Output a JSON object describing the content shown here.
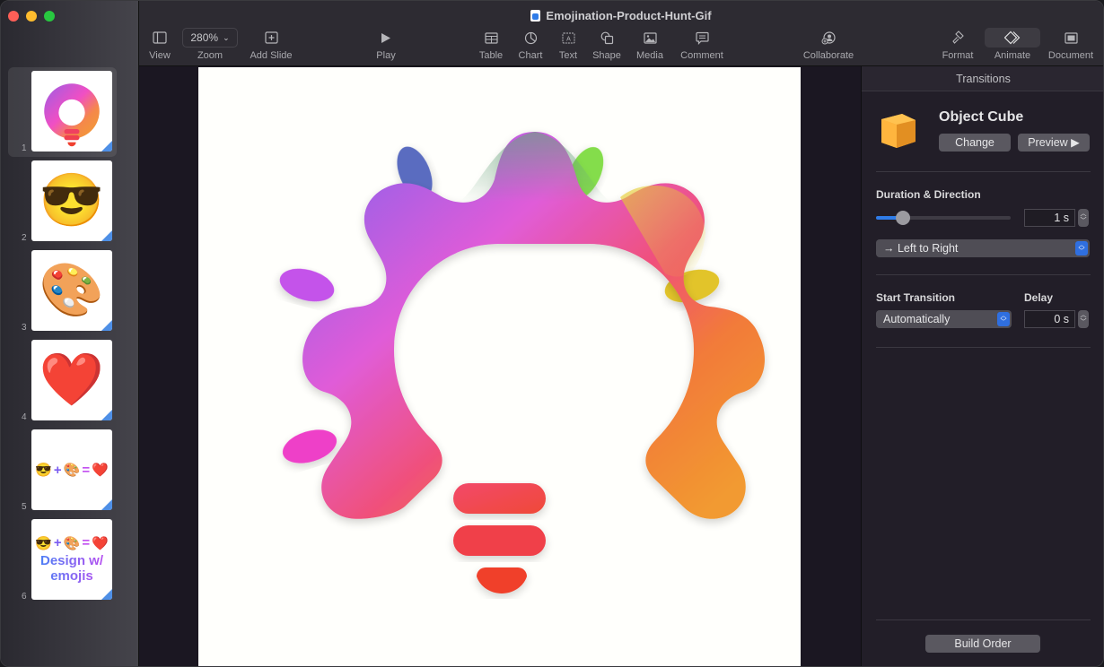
{
  "window": {
    "title": "Emojination-Product-Hunt-Gif"
  },
  "toolbar": {
    "view": "View",
    "zoom_value": "280%",
    "zoom": "Zoom",
    "add_slide": "Add Slide",
    "play": "Play",
    "table": "Table",
    "chart": "Chart",
    "text": "Text",
    "shape": "Shape",
    "media": "Media",
    "comment": "Comment",
    "collaborate": "Collaborate",
    "format": "Format",
    "animate": "Animate",
    "document": "Document",
    "active": "Animate"
  },
  "slides": [
    {
      "number": "1",
      "content": "lightbulb-logo",
      "selected": true
    },
    {
      "number": "2",
      "content": "😎"
    },
    {
      "number": "3",
      "content": "🎨"
    },
    {
      "number": "4",
      "content": "❤️"
    },
    {
      "number": "5",
      "eq": [
        "😎",
        "+",
        "🎨",
        "=",
        "❤️"
      ]
    },
    {
      "number": "6",
      "eq": [
        "😎",
        "+",
        "🎨",
        "=",
        "❤️"
      ],
      "caption_line1": "Design w/",
      "caption_line2": "emojis"
    }
  ],
  "inspector": {
    "tab": "Transitions",
    "transition_name": "Object Cube",
    "change": "Change",
    "preview": "Preview ▶",
    "duration_direction": "Duration & Direction",
    "duration_value": "1 s",
    "duration_slider_fraction": 0.2,
    "direction": "→  Left to Right",
    "start_transition": "Start Transition",
    "start_value": "Automatically",
    "delay": "Delay",
    "delay_value": "0 s",
    "build_order": "Build Order"
  },
  "colors": {
    "accent": "#2f7ce8",
    "close": "#fe5f57",
    "minimize": "#febc2e",
    "maximize": "#28c840"
  }
}
